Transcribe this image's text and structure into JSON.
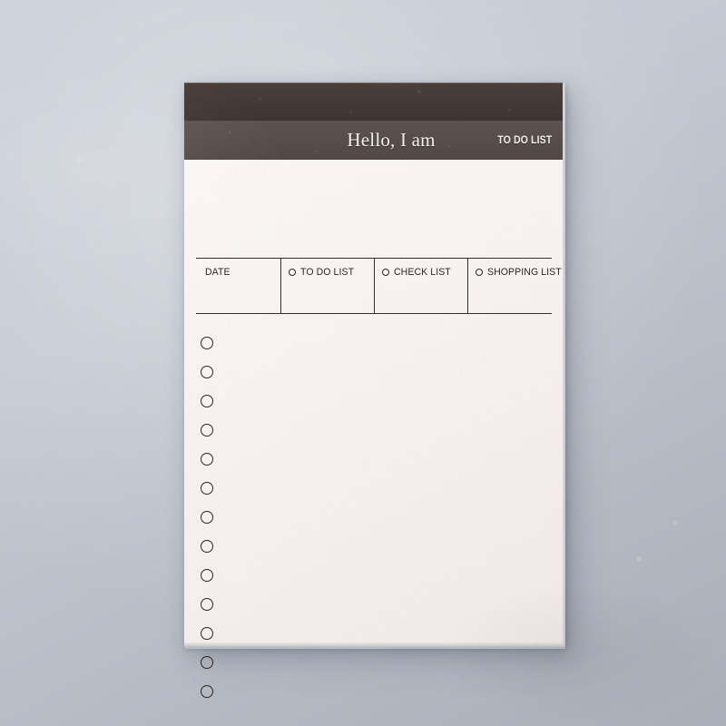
{
  "scene": {
    "background_color": "#c3c8d1",
    "surface_name": "desk-surface"
  },
  "notepad": {
    "paper_color": "#f7f0ee",
    "band_dark_color": "#443a36",
    "band_title_color": "#574d49",
    "ink_color": "#2c2623",
    "header": {
      "title": "Hello, I am",
      "kicker": "TO DO LIST"
    },
    "columns": [
      {
        "label": "DATE",
        "has_bullet": false
      },
      {
        "label": "TO DO LIST",
        "has_bullet": true
      },
      {
        "label": "CHECK LIST",
        "has_bullet": true
      },
      {
        "label": "SHOPPING LIST",
        "has_bullet": true
      }
    ],
    "checklist": {
      "row_count": 13,
      "rows": [
        {
          "index": 1,
          "checked": false,
          "text": ""
        },
        {
          "index": 2,
          "checked": false,
          "text": ""
        },
        {
          "index": 3,
          "checked": false,
          "text": ""
        },
        {
          "index": 4,
          "checked": false,
          "text": ""
        },
        {
          "index": 5,
          "checked": false,
          "text": ""
        },
        {
          "index": 6,
          "checked": false,
          "text": ""
        },
        {
          "index": 7,
          "checked": false,
          "text": ""
        },
        {
          "index": 8,
          "checked": false,
          "text": ""
        },
        {
          "index": 9,
          "checked": false,
          "text": ""
        },
        {
          "index": 10,
          "checked": false,
          "text": ""
        },
        {
          "index": 11,
          "checked": false,
          "text": ""
        },
        {
          "index": 12,
          "checked": false,
          "text": ""
        },
        {
          "index": 13,
          "checked": false,
          "text": ""
        }
      ]
    }
  }
}
